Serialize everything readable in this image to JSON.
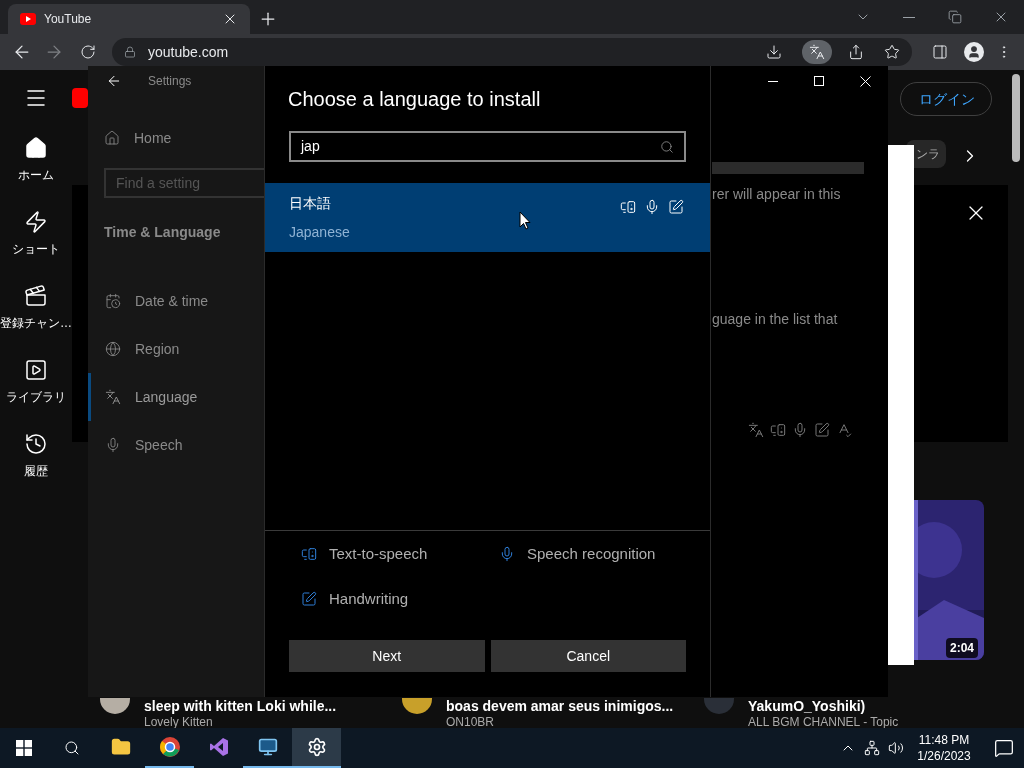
{
  "browser": {
    "tabs": [
      {
        "title": "YouTube",
        "selected": true
      }
    ],
    "url": "youtube.com"
  },
  "youtube": {
    "nav": [
      {
        "label": "ホーム"
      },
      {
        "label": "ショート"
      },
      {
        "label": "登録チャン…"
      },
      {
        "label": "ライブラリ"
      },
      {
        "label": "履歴"
      }
    ],
    "login": "ログイン",
    "chip": "ンラ",
    "duration": "2:04",
    "videos": [
      {
        "title": "sleep with kitten Loki while...",
        "channel": "Lovely Kitten"
      },
      {
        "title": "boas devem amar seus inimigos...",
        "channel": "ON10BR"
      },
      {
        "title": "YakumO_Yoshiki)",
        "channel": "ALL BGM CHANNEL - Topic"
      }
    ]
  },
  "settings": {
    "title": "Settings",
    "home": "Home",
    "search_placeholder": "Find a setting",
    "section": "Time & Language",
    "items": [
      {
        "label": "Date & time",
        "selected": false
      },
      {
        "label": "Region",
        "selected": false
      },
      {
        "label": "Language",
        "selected": true
      },
      {
        "label": "Speech",
        "selected": false
      }
    ],
    "fragments": [
      "rer will appear in this",
      "guage in the list that"
    ]
  },
  "dialog": {
    "title": "Choose a language to install",
    "search": {
      "value": "jap"
    },
    "results": [
      {
        "native": "日本語",
        "english": "Japanese",
        "selected": true
      }
    ],
    "legend": [
      {
        "label": "Text-to-speech"
      },
      {
        "label": "Speech recognition"
      },
      {
        "label": "Handwriting"
      }
    ],
    "buttons": [
      "Next",
      "Cancel"
    ]
  },
  "taskbar": {
    "apps": [
      {
        "running": false,
        "selected": false
      },
      {
        "running": true,
        "selected": false
      },
      {
        "running": false,
        "selected": false
      },
      {
        "running": true,
        "selected": false
      },
      {
        "running": true,
        "selected": true
      }
    ],
    "time": "11:48 PM",
    "date": "1/26/2023"
  }
}
